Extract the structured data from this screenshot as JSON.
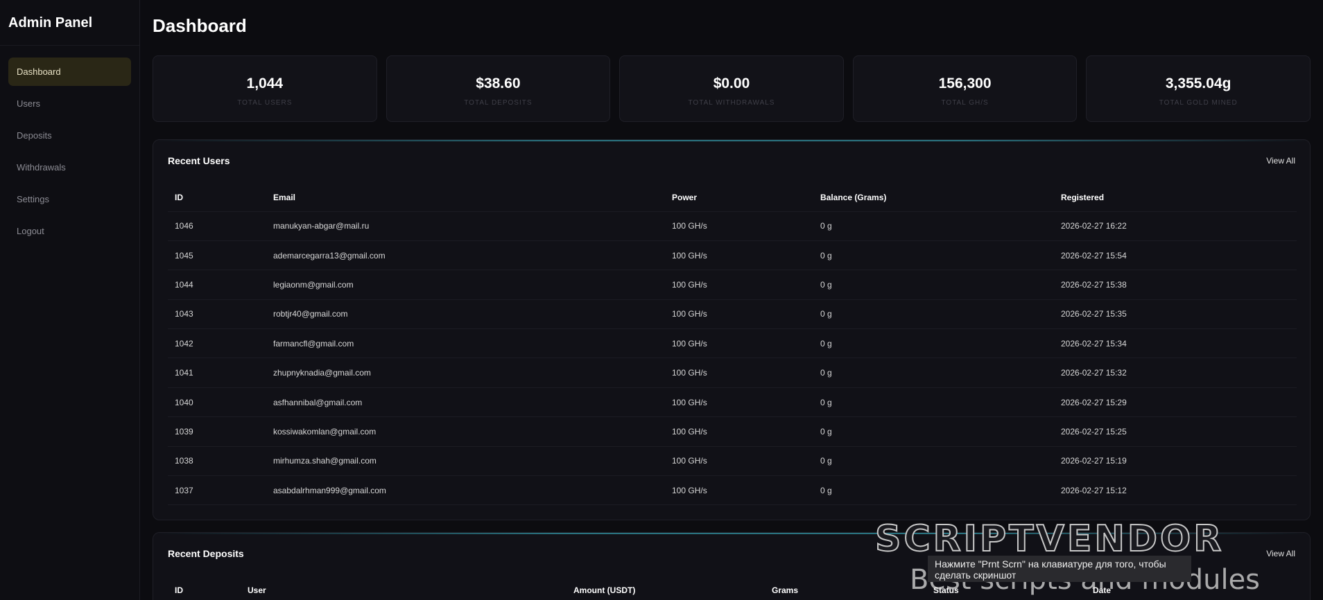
{
  "sidebar": {
    "brand": "Admin Panel",
    "items": [
      {
        "label": "Dashboard",
        "active": true
      },
      {
        "label": "Users"
      },
      {
        "label": "Deposits"
      },
      {
        "label": "Withdrawals"
      },
      {
        "label": "Settings"
      },
      {
        "label": "Logout"
      }
    ]
  },
  "page": {
    "title": "Dashboard"
  },
  "stats": [
    {
      "value": "1,044",
      "label": "TOTAL USERS"
    },
    {
      "value": "$38.60",
      "label": "TOTAL DEPOSITS"
    },
    {
      "value": "$0.00",
      "label": "TOTAL WITHDRAWALS"
    },
    {
      "value": "156,300",
      "label": "TOTAL GH/S"
    },
    {
      "value": "3,355.04g",
      "label": "TOTAL GOLD MINED"
    }
  ],
  "recent_users": {
    "title": "Recent Users",
    "view_all": "View All",
    "columns": [
      "ID",
      "Email",
      "Power",
      "Balance (Grams)",
      "Registered"
    ],
    "rows": [
      [
        "1046",
        "manukyan-abgar@mail.ru",
        "100 GH/s",
        "0 g",
        "2026-02-27 16:22"
      ],
      [
        "1045",
        "ademarcegarra13@gmail.com",
        "100 GH/s",
        "0 g",
        "2026-02-27 15:54"
      ],
      [
        "1044",
        "legiaonm@gmail.com",
        "100 GH/s",
        "0 g",
        "2026-02-27 15:38"
      ],
      [
        "1043",
        "robtjr40@gmail.com",
        "100 GH/s",
        "0 g",
        "2026-02-27 15:35"
      ],
      [
        "1042",
        "farmancfl@gmail.com",
        "100 GH/s",
        "0 g",
        "2026-02-27 15:34"
      ],
      [
        "1041",
        "zhupnyknadia@gmail.com",
        "100 GH/s",
        "0 g",
        "2026-02-27 15:32"
      ],
      [
        "1040",
        "asfhannibal@gmail.com",
        "100 GH/s",
        "0 g",
        "2026-02-27 15:29"
      ],
      [
        "1039",
        "kossiwakomlan@gmail.com",
        "100 GH/s",
        "0 g",
        "2026-02-27 15:25"
      ],
      [
        "1038",
        "mirhumza.shah@gmail.com",
        "100 GH/s",
        "0 g",
        "2026-02-27 15:19"
      ],
      [
        "1037",
        "asabdalrhman999@gmail.com",
        "100 GH/s",
        "0 g",
        "2026-02-27 15:12"
      ]
    ]
  },
  "recent_deposits": {
    "title": "Recent Deposits",
    "view_all": "View All",
    "columns": [
      "ID",
      "User",
      "Amount (USDT)",
      "Grams",
      "Status",
      "Date"
    ]
  },
  "watermark": {
    "title": "SCRIPTVENDOR",
    "tooltip": "Нажмите \"Prnt Scrn\" на клавиатуре для того, чтобы сделать скриншот",
    "subtitle": "Best scripts and modules"
  },
  "colors": {
    "background": "#0c0c10",
    "card": "#121218",
    "active_nav": "#2a2716",
    "accent_line": "#2a7380"
  }
}
